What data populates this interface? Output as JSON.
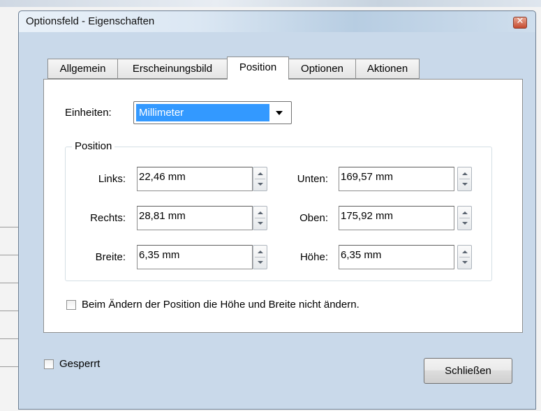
{
  "window": {
    "title": "Optionsfeld - Eigenschaften",
    "close_glyph": "✕"
  },
  "tabs": [
    {
      "label": "Allgemein",
      "active": false
    },
    {
      "label": "Erscheinungsbild",
      "active": false
    },
    {
      "label": "Position",
      "active": true
    },
    {
      "label": "Optionen",
      "active": false
    },
    {
      "label": "Aktionen",
      "active": false
    }
  ],
  "units": {
    "label": "Einheiten:",
    "value": "Millimeter"
  },
  "position": {
    "legend": "Position",
    "left": {
      "label": "Links:",
      "value": "22,46 mm"
    },
    "right": {
      "label": "Rechts:",
      "value": "28,81 mm"
    },
    "width": {
      "label": "Breite:",
      "value": "6,35 mm"
    },
    "bottom": {
      "label": "Unten:",
      "value": "169,57 mm"
    },
    "top": {
      "label": "Oben:",
      "value": "175,92 mm"
    },
    "height": {
      "label": "Höhe:",
      "value": "6,35 mm"
    }
  },
  "keep_size": {
    "label": "Beim Ändern der Position die Höhe und Breite nicht ändern.",
    "checked": false
  },
  "locked": {
    "label": "Gesperrt",
    "checked": false
  },
  "close_button": {
    "label": "Schließen"
  },
  "colors": {
    "selection": "#3399ff",
    "close_button": "#c54a2f",
    "panel": "#ffffff",
    "client": "#f0f0f0"
  }
}
